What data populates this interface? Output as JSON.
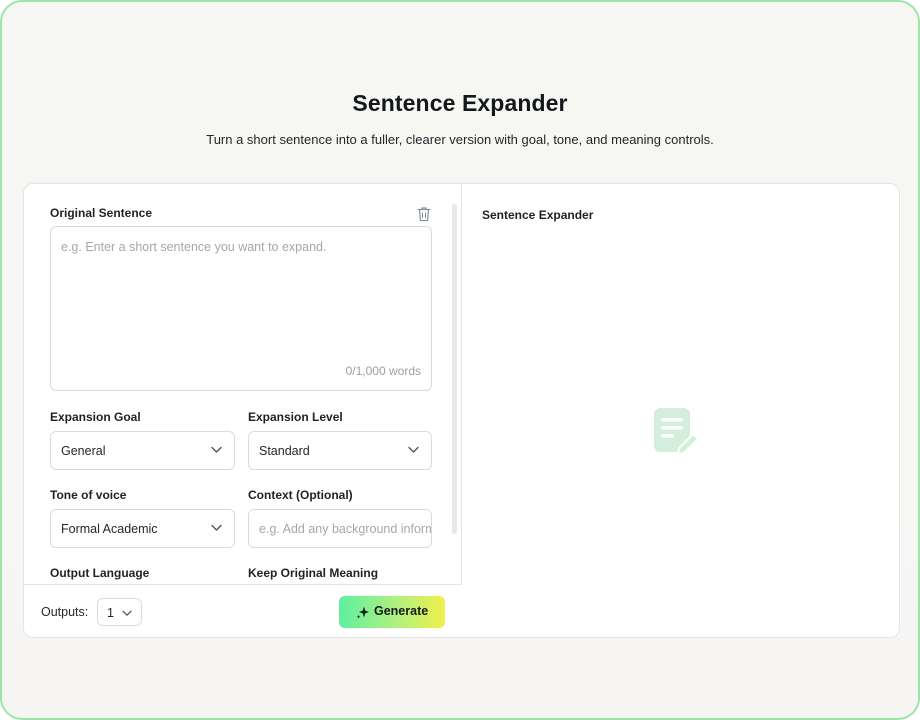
{
  "header": {
    "title": "Sentence Expander",
    "subtitle": "Turn a short sentence into a fuller, clearer version with goal, tone, and meaning controls."
  },
  "form": {
    "original_sentence": {
      "label": "Original Sentence",
      "placeholder": "e.g. Enter a short sentence you want to expand.",
      "value": "",
      "counter": "0/1,000 words"
    },
    "expansion_goal": {
      "label": "Expansion Goal",
      "value": "General"
    },
    "expansion_level": {
      "label": "Expansion Level",
      "value": "Standard"
    },
    "tone_of_voice": {
      "label": "Tone of voice",
      "value": "Formal Academic"
    },
    "context": {
      "label": "Context (Optional)",
      "placeholder": "e.g. Add any background information",
      "value": ""
    },
    "output_language": {
      "label": "Output Language"
    },
    "keep_original_meaning": {
      "label": "Keep Original Meaning"
    }
  },
  "footer": {
    "outputs_label": "Outputs:",
    "outputs_value": "1",
    "generate_label": "Generate"
  },
  "result": {
    "title": "Sentence Expander"
  },
  "icons": {
    "trash": "trash-icon",
    "chevron": "chevron-down-icon",
    "sparkle": "sparkle-icon",
    "empty_state": "document-edit-icon"
  },
  "colors": {
    "accent_gradient_start": "#5ef0a0",
    "accent_gradient_end": "#eef04a",
    "frame_border": "#9ee3a8",
    "empty_icon": "#cfeed8"
  }
}
